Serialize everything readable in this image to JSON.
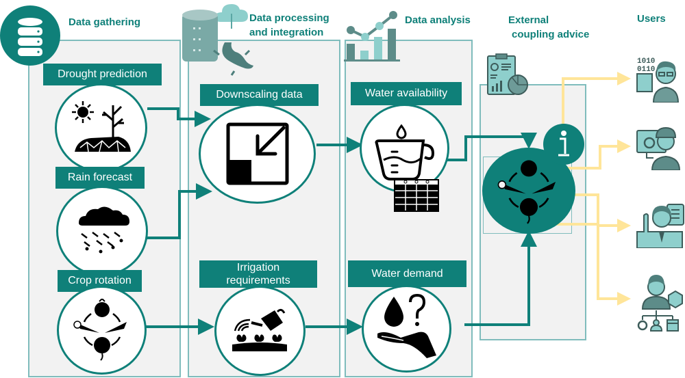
{
  "stages": [
    {
      "id": "gathering",
      "title": "Data gathering",
      "icon": "database-icon"
    },
    {
      "id": "processing",
      "title": "Data processing and integration",
      "title_lines": [
        "Data processing",
        "and integration"
      ],
      "icon": "server-cloud-salamander-icon"
    },
    {
      "id": "analysis",
      "title": "Data analysis",
      "icon": "bar-line-chart-icon"
    },
    {
      "id": "coupling",
      "title": "External coupling advice",
      "title_lines": [
        "External",
        "coupling advice"
      ],
      "icon": "clipboard-report-icon"
    },
    {
      "id": "users",
      "title": "Users"
    }
  ],
  "nodes": {
    "drought": {
      "label": "Drought prediction",
      "icon": "drought-icon"
    },
    "rain": {
      "label": "Rain forecast",
      "icon": "rain-cloud-icon"
    },
    "crop": {
      "label": "Crop rotation",
      "icon": "crop-rotation-icon"
    },
    "downscaling": {
      "label": "Downscaling data",
      "icon": "downscale-icon"
    },
    "irrigation": {
      "label": "Irrigation requirements",
      "label_lines": [
        "Irrigation",
        "requirements"
      ],
      "icon": "watering-can-icon"
    },
    "availability": {
      "label": "Water availability",
      "icon": "measuring-jug-calendar-icon"
    },
    "demand": {
      "label": "Water demand",
      "icon": "water-hand-question-icon"
    },
    "advice": {
      "icon": "crop-rotation-icon",
      "badge_icon": "info-icon"
    }
  },
  "users": [
    {
      "icon": "data-scientist-user-icon"
    },
    {
      "icon": "technician-user-icon"
    },
    {
      "icon": "advisor-user-icon"
    },
    {
      "icon": "manager-user-icon"
    }
  ],
  "colors": {
    "teal": "#0f8079",
    "panel_border": "#7fbcbc",
    "panel_bg": "#f2f2f2",
    "user_arrow": "#ffe599",
    "icon_fill": "#8ecfcc",
    "icon_dark": "#3d5c5a"
  }
}
